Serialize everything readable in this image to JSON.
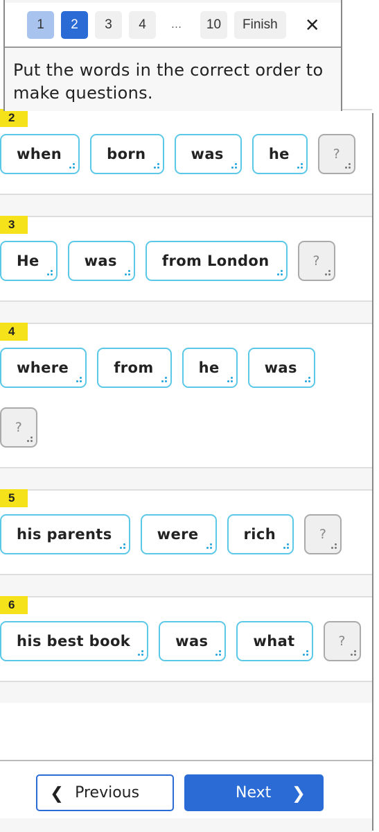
{
  "pagination": {
    "pages": [
      {
        "label": "1",
        "state": "visited"
      },
      {
        "label": "2",
        "state": "current"
      },
      {
        "label": "3",
        "state": "default"
      },
      {
        "label": "4",
        "state": "default"
      },
      {
        "label": "…",
        "state": "ellipsis"
      },
      {
        "label": "10",
        "state": "default"
      }
    ],
    "finish_label": "Finish",
    "close_icon": "×"
  },
  "instructions": "Put the words in the correct order to make questions.",
  "questions": [
    {
      "number": "2",
      "words": [
        "when",
        "born",
        "was",
        "he"
      ],
      "blank": "?"
    },
    {
      "number": "3",
      "words": [
        "He",
        "was",
        "from London"
      ],
      "blank": "?"
    },
    {
      "number": "4",
      "words": [
        "where",
        "from",
        "he",
        "was"
      ],
      "blank": "?"
    },
    {
      "number": "5",
      "words": [
        "his parents",
        "were",
        "rich"
      ],
      "blank": "?"
    },
    {
      "number": "6",
      "words": [
        "his best book",
        "was",
        "what"
      ],
      "blank": "?"
    }
  ],
  "footer": {
    "previous_label": "Previous",
    "previous_icon": "❮",
    "next_label": "Next",
    "next_icon": "❯"
  },
  "colors": {
    "accent": "#2a6bd6",
    "visited_page": "#a9c3ef",
    "chip_border": "#5cc8e8",
    "number_badge": "#f5e21a"
  }
}
